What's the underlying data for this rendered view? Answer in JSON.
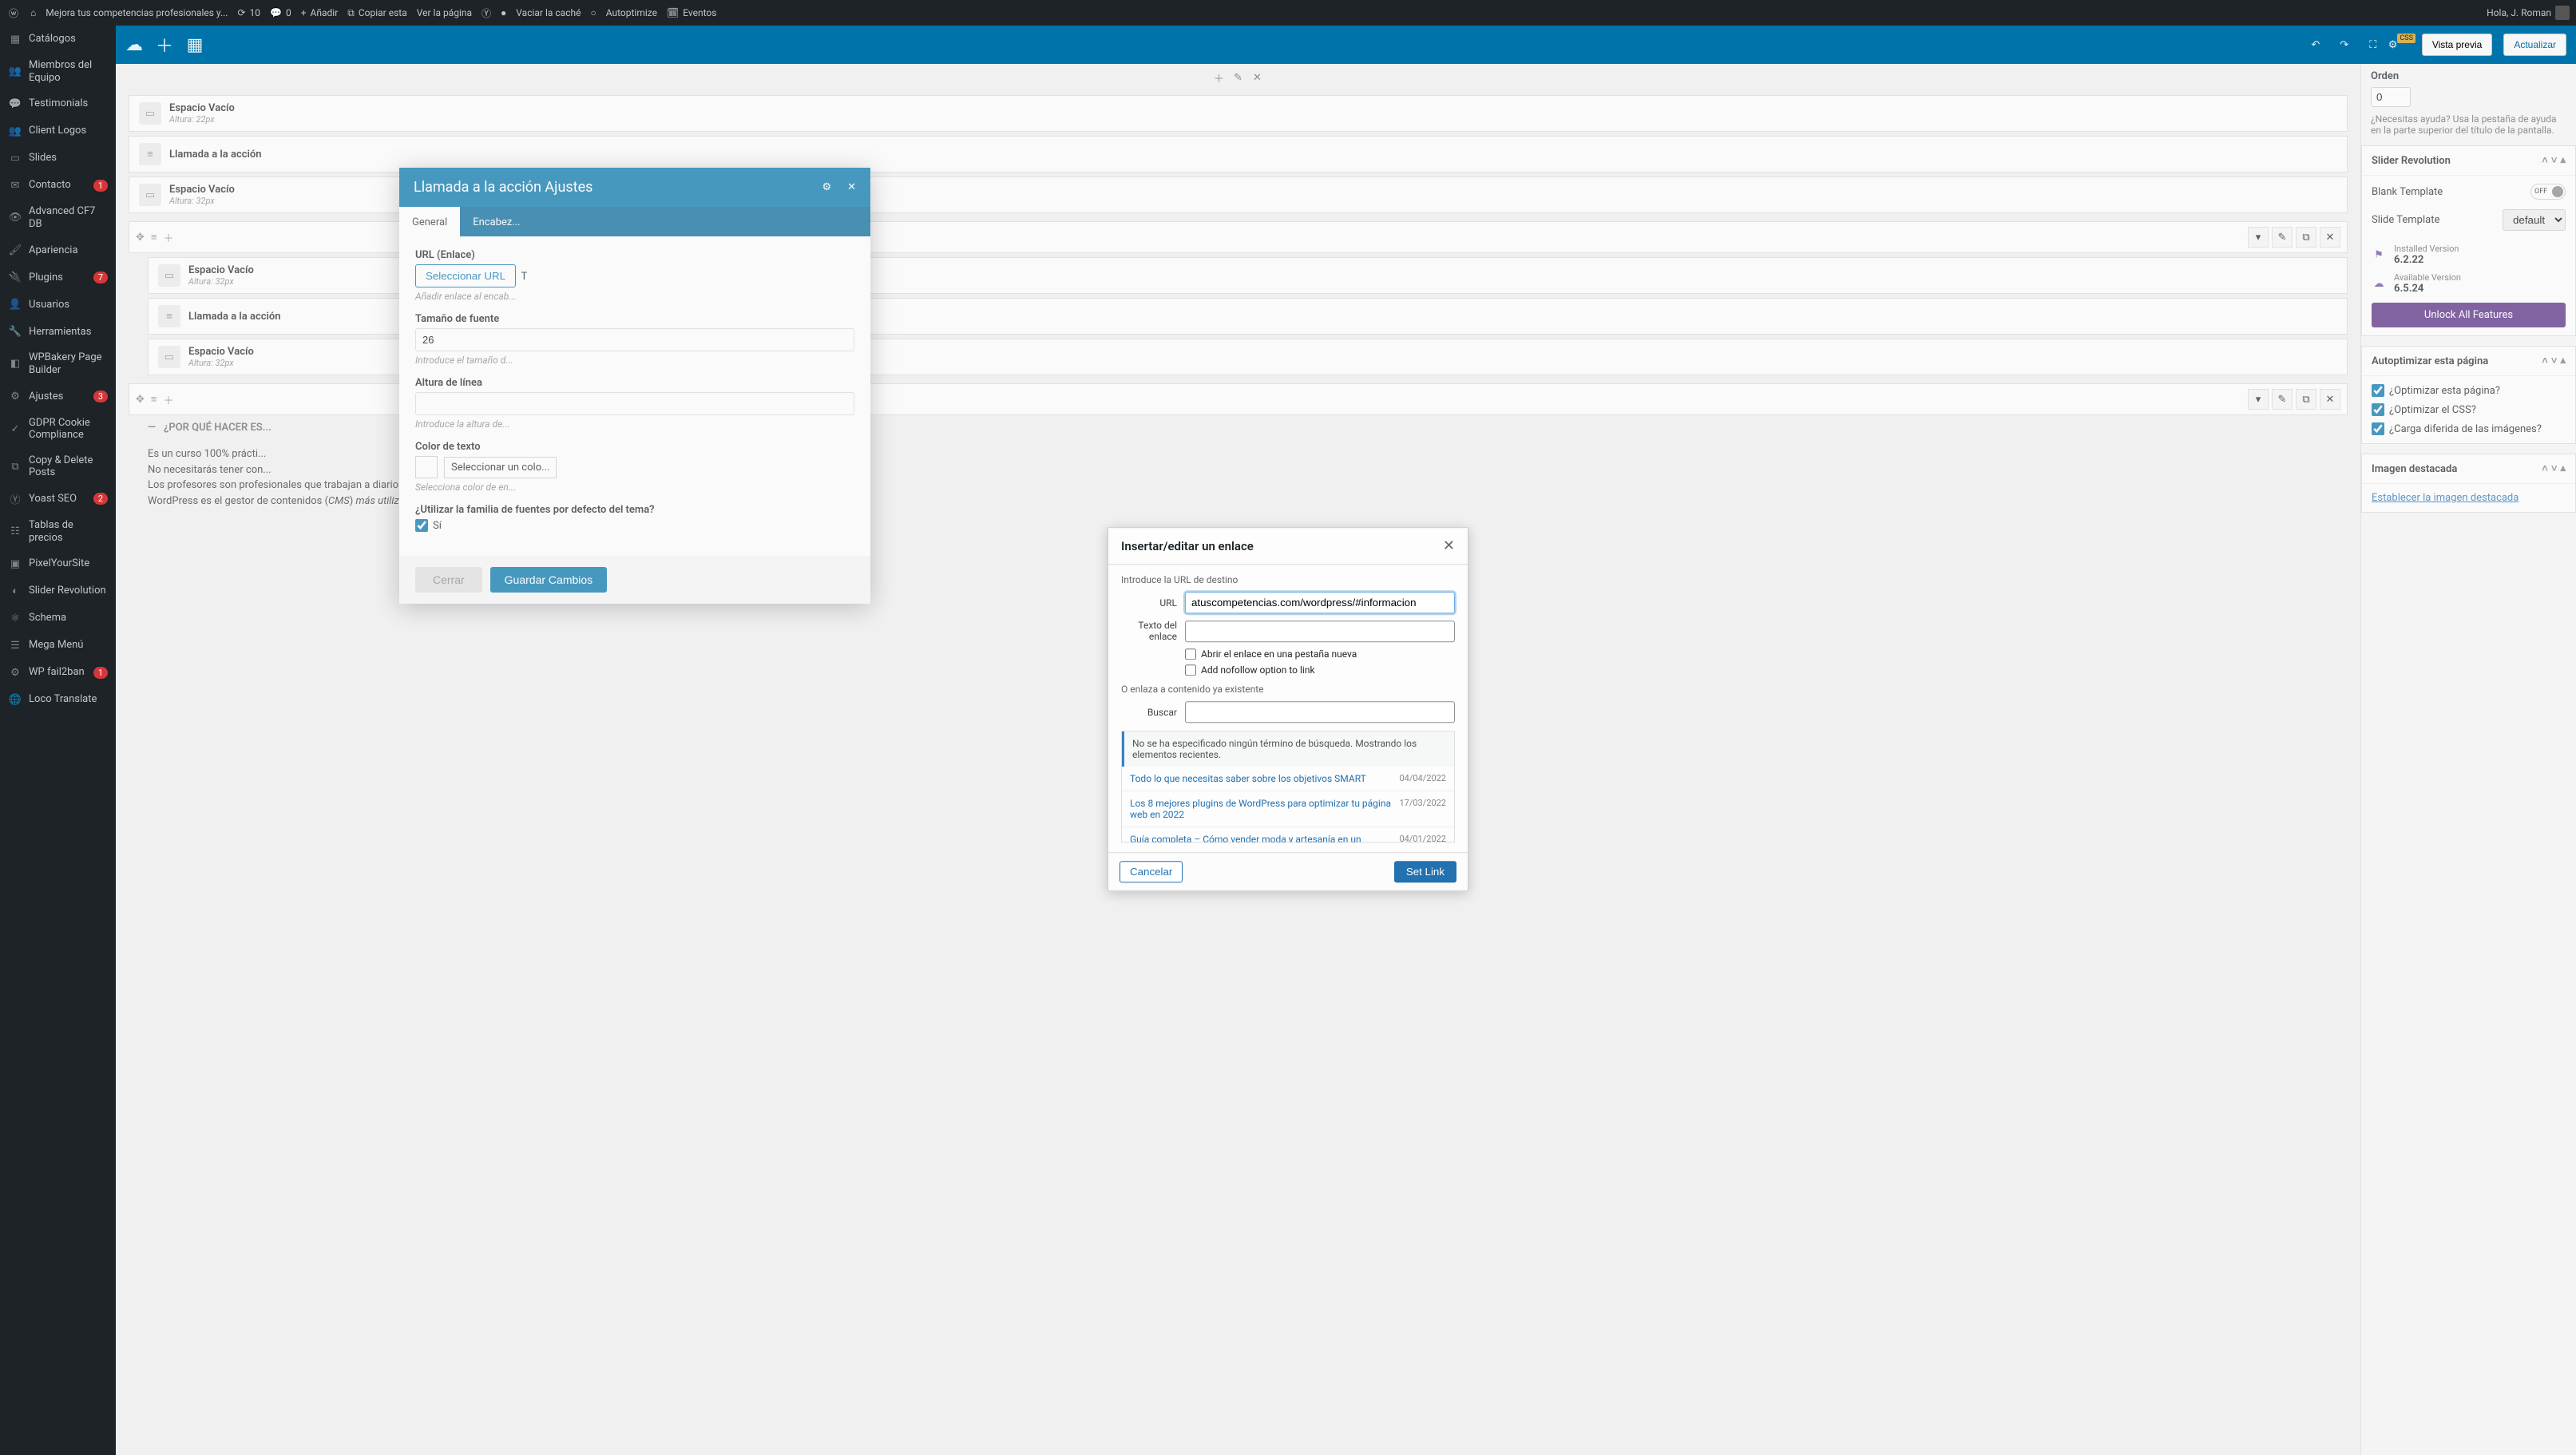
{
  "adminBar": {
    "siteTitle": "Mejora tus competencias profesionales y...",
    "updates": "10",
    "comments": "0",
    "add": "Añadir",
    "copy": "Copiar esta",
    "view": "Ver la página",
    "clearCache": "Vaciar la caché",
    "autoptimize": "Autoptimize",
    "events": "Eventos",
    "greeting": "Hola, J. Roman"
  },
  "sidebar": {
    "items": [
      {
        "label": "Catálogos",
        "icon": "grid"
      },
      {
        "label": "Miembros del Equipo",
        "icon": "users"
      },
      {
        "label": "Testimonials",
        "icon": "chat"
      },
      {
        "label": "Client Logos",
        "icon": "users"
      },
      {
        "label": "Slides",
        "icon": "slides"
      },
      {
        "label": "Contacto",
        "icon": "mail",
        "badge": "1"
      },
      {
        "label": "Advanced CF7 DB",
        "icon": "eye"
      },
      {
        "label": "Apariencia",
        "icon": "brush"
      },
      {
        "label": "Plugins",
        "icon": "plug",
        "badge": "7"
      },
      {
        "label": "Usuarios",
        "icon": "user"
      },
      {
        "label": "Herramientas",
        "icon": "wrench"
      },
      {
        "label": "WPBakery Page Builder",
        "icon": "wpbakery"
      },
      {
        "label": "Ajustes",
        "icon": "sliders",
        "badge": "3"
      },
      {
        "label": "GDPR Cookie Compliance",
        "icon": "check"
      },
      {
        "label": "Copy & Delete Posts",
        "icon": "copy"
      },
      {
        "label": "Yoast SEO",
        "icon": "yoast",
        "badge": "2"
      },
      {
        "label": "Tablas de precios",
        "icon": "table"
      },
      {
        "label": "PixelYourSite",
        "icon": "pixel"
      },
      {
        "label": "Slider Revolution",
        "icon": "rev"
      },
      {
        "label": "Schema",
        "icon": "schema"
      },
      {
        "label": "Mega Menú",
        "icon": "menu"
      },
      {
        "label": "WP fail2ban",
        "icon": "shield",
        "badge": "1"
      },
      {
        "label": "Loco Translate",
        "icon": "translate"
      }
    ]
  },
  "editorHeader": {
    "cssBadge": "CSS",
    "preview": "Vista previa",
    "update": "Actualizar"
  },
  "canvas": {
    "blocks": [
      {
        "title": "Espacio Vacío",
        "sub": "Altura: 22px"
      },
      {
        "title": "Llamada a la acción",
        "sub": ""
      },
      {
        "title": "Espacio Vacío",
        "sub": "Altura: 32px"
      }
    ],
    "blocks2": [
      {
        "title": "Espacio Vacío",
        "sub": "Altura: 32px"
      },
      {
        "title": "Llamada a la acción",
        "sub": ""
      },
      {
        "title": "Espacio Vacío",
        "sub": "Altura: 32px"
      }
    ],
    "accordion": "¿POR QUÉ HACER ES...",
    "bodyText": {
      "l1": "Es un curso 100% prácti...",
      "l2": "No necesitarás tener con...",
      "l3": "Los profesores son profesionales que trabajan a diario con WordPress.",
      "l4a": "WordPress es el gestor de contenidos (",
      "l4b": "CMS",
      "l4c": ") ",
      "l4d": "más utilizado en el mundo",
      "l4e": "."
    }
  },
  "settingsPanel": {
    "title": "Llamada a la acción Ajustes",
    "tabs": {
      "general": "General",
      "header": "Encabez..."
    },
    "urlLabel": "URL (Enlace)",
    "selectUrl": "Seleccionar URL",
    "titleLabel": "T",
    "urlHint": "Añadir enlace al encab...",
    "fontSizeLabel": "Tamaño de fuente",
    "fontSizeValue": "26",
    "fontSizeHint": "Introduce el tamaño d...",
    "lineHeightLabel": "Altura de línea",
    "lineHeightHint": "Introduce la altura de...",
    "textColorLabel": "Color de texto",
    "selectColor": "Seleccionar un colo...",
    "textColorHint": "Selecciona color de en...",
    "fontFamilyLabel": "¿Utilizar la familia de fuentes por defecto del tema?",
    "fontFamilyYes": "Sí",
    "closeBtn": "Cerrar",
    "saveBtn": "Guardar Cambios"
  },
  "modal": {
    "title": "Insertar/editar un enlace",
    "introUrl": "Introduce la URL de destino",
    "urlLabel": "URL",
    "urlValue": "atuscompetencias.com/wordpress/#informacion",
    "linkTextLabel": "Texto del enlace",
    "linkTextValue": "",
    "newTab": "Abrir el enlace en una pestaña nueva",
    "nofollow": "Add nofollow option to link",
    "existing": "O enlaza a contenido ya existente",
    "searchLabel": "Buscar",
    "searchValue": "",
    "noTerm": "No se ha especificado ningún término de búsqueda. Mostrando los elementos recientes.",
    "results": [
      {
        "title": "Todo lo que necesitas saber sobre los objetivos SMART",
        "date": "04/04/2022"
      },
      {
        "title": "Los 8 mejores plugins de WordPress para optimizar tu página web en 2022",
        "date": "17/03/2022"
      },
      {
        "title": "Guía completa – Cómo vender moda y artesanía en un marketplace digital",
        "date": "04/01/2022"
      }
    ],
    "cancel": "Cancelar",
    "setLink": "Set Link"
  },
  "rightPanel": {
    "order": {
      "label": "Orden",
      "value": "0"
    },
    "help": "¿Necesitas ayuda? Usa la pestaña de ayuda en la parte superior del título de la pantalla.",
    "sliderRev": {
      "title": "Slider Revolution",
      "blankTemplate": "Blank Template",
      "off": "OFF",
      "slideTemplate": "Slide Template",
      "slideValue": "default",
      "installedLabel": "Installed Version",
      "installedValue": "6.2.22",
      "availableLabel": "Available Version",
      "availableValue": "6.5.24",
      "unlock": "Unlock All Features"
    },
    "autoptimize": {
      "title": "Autoptimizar esta página",
      "opt1": "¿Optimizar esta página?",
      "opt2": "¿Optimizar el CSS?",
      "opt3": "¿Carga diferida de las imágenes?"
    },
    "featuredImg": {
      "title": "Imagen destacada",
      "link": "Establecer la imagen destacada"
    }
  }
}
